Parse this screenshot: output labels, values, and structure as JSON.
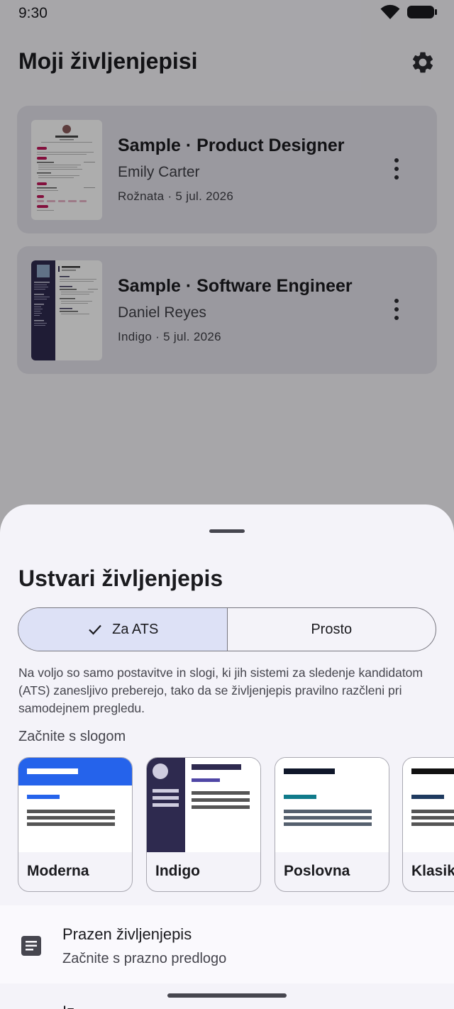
{
  "status_bar": {
    "time": "9:30"
  },
  "app": {
    "title": "Moji življenjepisi",
    "resumes": [
      {
        "title": "Sample · Product Designer",
        "name": "Emily Carter",
        "meta": "Rožnata · 5 jul. 2026"
      },
      {
        "title": "Sample · Software Engineer",
        "name": "Daniel Reyes",
        "meta": "Indigo · 5 jul. 2026"
      }
    ]
  },
  "sheet": {
    "title": "Ustvari življenjepis",
    "segments": {
      "ats_label": "Za ATS",
      "plain_label": "Prosto",
      "selected": "Za ATS"
    },
    "description": "Na voljo so samo postavitve in slogi, ki jih sistemi za sledenje kandidatom (ATS) zanesljivo preberejo, tako da se življenjepis pravilno razčleni pri samodejnem pregledu.",
    "templates_label": "Začnite s slogom",
    "templates": [
      {
        "name": "Moderna",
        "accent": "#2563eb"
      },
      {
        "name": "Indigo",
        "accent": "#2e2a4f"
      },
      {
        "name": "Poslovna",
        "accent": "#0f172a"
      },
      {
        "name": "Klasik",
        "accent": "#1e3a5f"
      }
    ],
    "blank": {
      "title": "Prazen življenjepis",
      "subtitle": "Začnite s prazno predlogo"
    },
    "next_item_peek": "Iz..."
  },
  "colors": {
    "scrim": "rgba(0,0,0,0.32)",
    "segment_active": "#dde1f6",
    "card_bg": "#e3e2ea"
  }
}
